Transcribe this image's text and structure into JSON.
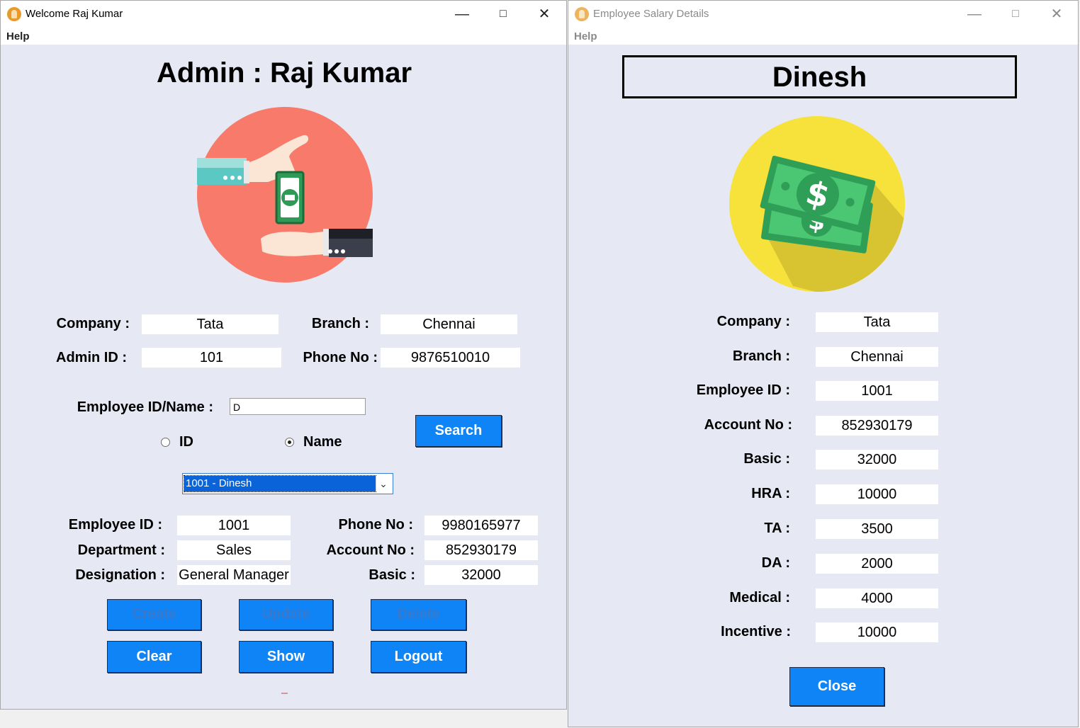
{
  "admin_window": {
    "title": "Welcome Raj Kumar",
    "menu": [
      "Help"
    ],
    "heading": "Admin : Raj Kumar",
    "company_label": "Company :",
    "company_value": "Tata",
    "branch_label": "Branch :",
    "branch_value": "Chennai",
    "admin_id_label": "Admin ID :",
    "admin_id_value": "101",
    "phone_label": "Phone No :",
    "phone_value": "9876510010",
    "search_label": "Employee ID/Name :",
    "search_value": "D",
    "search_button": "Search",
    "radio_id_label": "ID",
    "radio_name_label": "Name",
    "radio_selected": "Name",
    "selected_employee": "1001 - Dinesh",
    "emp_id_label": "Employee ID :",
    "emp_id_value": "1001",
    "department_label": "Department :",
    "department_value": "Sales",
    "designation_label": "Designation :",
    "designation_value": "General Manager",
    "emp_phone_label": "Phone No :",
    "emp_phone_value": "9980165977",
    "account_label": "Account No :",
    "account_value": "852930179",
    "basic_label": "Basic :",
    "basic_value": "32000",
    "buttons": {
      "create": "Create",
      "update": "Update",
      "delete": "Delete",
      "clear": "Clear",
      "show": "Show",
      "logout": "Logout"
    },
    "status": "---"
  },
  "salary_window": {
    "title": "Employee Salary Details",
    "menu": [
      "Help"
    ],
    "name": "Dinesh",
    "rows": [
      {
        "label": "Company :",
        "value": "Tata"
      },
      {
        "label": "Branch :",
        "value": "Chennai"
      },
      {
        "label": "Employee ID :",
        "value": "1001"
      },
      {
        "label": "Account No :",
        "value": "852930179"
      },
      {
        "label": "Basic :",
        "value": "32000"
      },
      {
        "label": "HRA :",
        "value": "10000"
      },
      {
        "label": "TA :",
        "value": "3500"
      },
      {
        "label": "DA :",
        "value": "2000"
      },
      {
        "label": "Medical :",
        "value": "4000"
      },
      {
        "label": "Incentive :",
        "value": "10000"
      }
    ],
    "close_button": "Close"
  },
  "colors": {
    "window_bg": "#e6e8f4",
    "button_blue": "#0f84f6",
    "disabled_text": "#3a79c9",
    "admin_icon_bg": "#f77a6a",
    "salary_icon_bg": "#f7e23b",
    "money_green": "#3ec46d"
  },
  "icons": [
    "app-icon",
    "money-handover-icon",
    "dollar-bills-icon",
    "chevron-down-icon",
    "minimize-icon",
    "maximize-icon",
    "close-icon"
  ]
}
